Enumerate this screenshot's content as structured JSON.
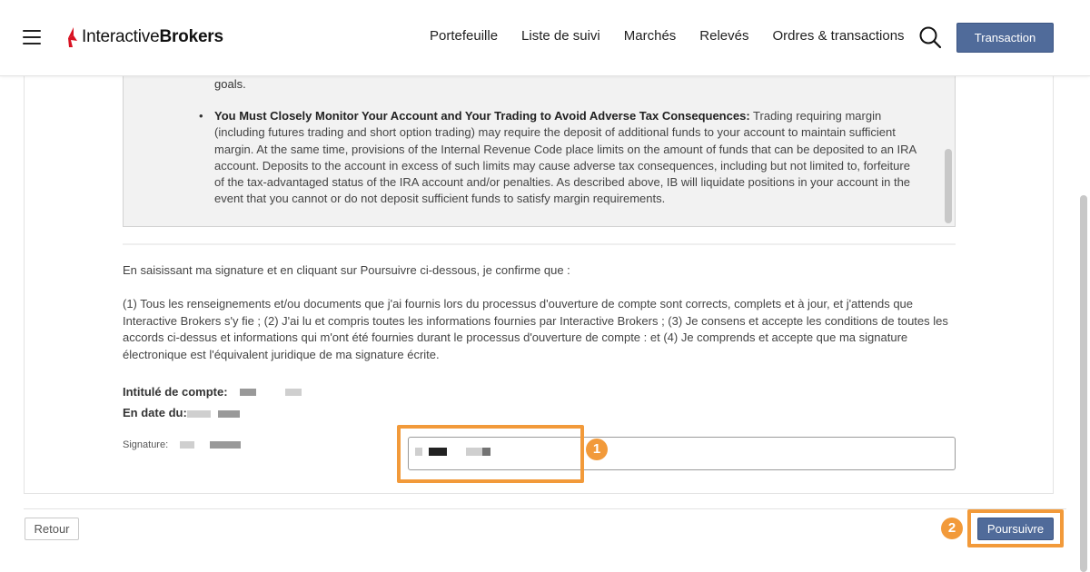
{
  "header": {
    "logo_regular": "Interactive",
    "logo_bold": "Brokers",
    "nav": [
      "Portefeuille",
      "Liste de suivi",
      "Marchés",
      "Relevés",
      "Ordres & transactions"
    ],
    "transaction_button": "Transaction",
    "icons": {
      "menu": "hamburger-icon",
      "search": "search-icon",
      "logo": "ib-logo-icon"
    },
    "brand_color": "#d81222",
    "button_color": "#506b9a"
  },
  "disclosure": {
    "top_text": "goals.",
    "bullet_title": "You Must Closely Monitor Your Account and Your Trading to Avoid Adverse Tax Consequences:",
    "bullet_text": "Trading requiring margin (including futures trading and short option trading) may require the deposit of additional funds to your account to maintain sufficient margin. At the same time, provisions of the Internal Revenue Code place limits on the amount of funds that can be deposited to an IRA account. Deposits to the account in excess of such limits may cause adverse tax consequences, including but not limited to, forfeiture of the tax-advantaged status of the IRA account and/or penalties. As described above, IB will liquidate positions in your account in the event that you cannot or do not deposit sufficient funds to satisfy margin requirements."
  },
  "confirmation": {
    "intro": "En saisissant ma signature et en cliquant sur Poursuivre ci-dessous, je confirme que :",
    "body": "(1) Tous les renseignements et/ou documents que j'ai fournis lors du processus d'ouverture de compte sont corrects, complets et à jour, et j'attends que Interactive Brokers s'y fie ; (2) J'ai lu et compris toutes les informations fournies par Interactive Brokers ; (3) Je consens et accepte les conditions de toutes les accords ci-dessus et informations qui m'ont été fournies durant le processus d'ouverture de compte : et (4) Je comprends et accepte que ma signature électronique est l'équivalent juridique de ma signature écrite."
  },
  "fields": {
    "account_title_label": "Intitulé de compte:",
    "date_label": "En date du:",
    "signature_label": "Signature:"
  },
  "annotations": {
    "step1": "1",
    "step2": "2",
    "highlight_color": "#f29a3a"
  },
  "footer": {
    "back_button": "Retour",
    "continue_button": "Poursuivre"
  }
}
